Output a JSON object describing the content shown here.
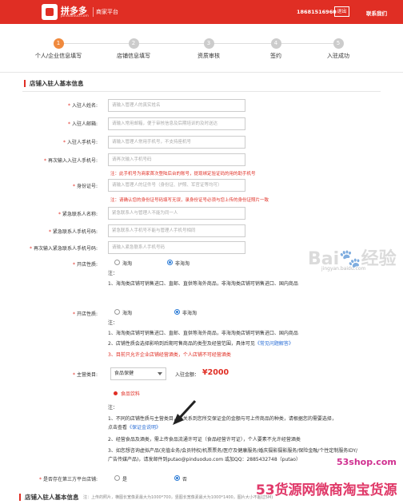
{
  "header": {
    "brand": "拼多多",
    "brand_sub": "pinduoduo.com",
    "platform": "商家平台",
    "phone": "18681516960",
    "logout": "退出",
    "contact": "联系我们"
  },
  "steps": [
    {
      "num": "1",
      "label": "个人/企业信息填写",
      "active": true
    },
    {
      "num": "2",
      "label": "店铺信息填写",
      "active": false
    },
    {
      "num": "3",
      "label": "资质审核",
      "active": false
    },
    {
      "num": "4",
      "label": "签约",
      "active": false
    },
    {
      "num": "5",
      "label": "入驻成功",
      "active": false
    }
  ],
  "section1": {
    "title": "店铺入驻人基本信息",
    "fields": [
      {
        "label": "入驻人姓名:",
        "placeholder": "请输入管理人的真实姓名"
      },
      {
        "label": "入驻人邮箱:",
        "placeholder": "请输入常用邮箱，便于审核信息及后期培训的及时送达"
      },
      {
        "label": "入驻人手机号:",
        "placeholder": "请输入管理人常用手机号，不支持座机号"
      },
      {
        "label": "再次输入入驻人手机号:",
        "placeholder": "请再次输入手机号码"
      },
      {
        "label": "身份证号:",
        "placeholder": "请输入管理人的证件号（身份证、护照、军官证等均可）"
      },
      {
        "label": "紧急联系人名称:",
        "placeholder": "紧急联系人与管理人不能为同一人"
      },
      {
        "label": "紧急联系人手机号码:",
        "placeholder": "紧急联系人手机号不能与管理人手机号相同"
      },
      {
        "label": "再次输入紧急联系人手机号码:",
        "placeholder": "请输入紧急联系人手机号码"
      }
    ],
    "note_phone": "注：此手机号为商家首次登陆后台的账号，提现绑定验证码的用的助手机号",
    "note_id": "注：请确认您的身份证号码填写无误，录身份证号必须与您上传的身份证照片一致",
    "shop_type_label": "开店性质:",
    "radio_haitao": "海淘",
    "radio_non_haitao": "非海淘",
    "note_head": "注：",
    "note_1": "1、海淘类店铺可销售进口、直邮、直供等海外商品，非海淘类店铺可销售进口、国内商品"
  },
  "section2": {
    "shop_type_label": "开店性质:",
    "radio_haitao": "海淘",
    "radio_non_haitao": "非海淘",
    "note_head": "注：",
    "note_1": "1、海淘类店铺可销售进口、直邮、直供等海外商品，非海淘类店铺可销售进口、国内商品",
    "note_2a": "2、店铺性质会选择影响到后期可售商品的类型及经营范围，具体可见",
    "note_2_link": "《常见问题解答》",
    "note_3": "3、目前只允许企业店铺经营酒类，个人店铺不可经营酒类",
    "category_label": "主营类目:",
    "category_value": "食品保健",
    "deposit_label": "入驻金额：",
    "deposit_value": "¥2000",
    "subcategory": "食品饮料",
    "note2_head": "注：",
    "note2_1a": "1、不同的店铺性质与主营类目，将关系到您所交保证金的金额与可上传商品的种类，请根据您的需要选择，",
    "note2_1b": "点击查看",
    "note2_1_link": "《保证金说明》",
    "note2_2": "2、经营食品及酒类，需上传食品流通许可证（食品经营许可证），个人要素不允许经营酒类",
    "note2_3a": "3、如您想咨询虚拟产品(充值业务/会员特权/机票票务/医疗及健康服务/婚庆摄影摄影服务/保险金融/个性定制服务IDY/",
    "note2_3b": "广告传媒产品)，请发邮件到putao@pinduoduo.com 或加QQ：2885432748（putao）",
    "third_party_label": "是否存在第三方平台店铺:",
    "radio_yes": "是",
    "radio_no": "否",
    "bottom_title": "店铺入驻人基本信息",
    "bottom_hint": "注：上传的照片，横图长宽像素最大为1000*700，竖图长宽像素最大为1000*1400，图片大小不超过5M)"
  },
  "watermarks": {
    "baidu": "Bai",
    "baidu2": "经验",
    "baidu_url": "jingyan.baidu.com",
    "site": "53shop.com",
    "banner": "53货源网微商淘宝货源"
  },
  "colors": {
    "brand_red": "#e02e24",
    "step_active": "#f08a3e",
    "link_blue": "#2a6ed6"
  }
}
